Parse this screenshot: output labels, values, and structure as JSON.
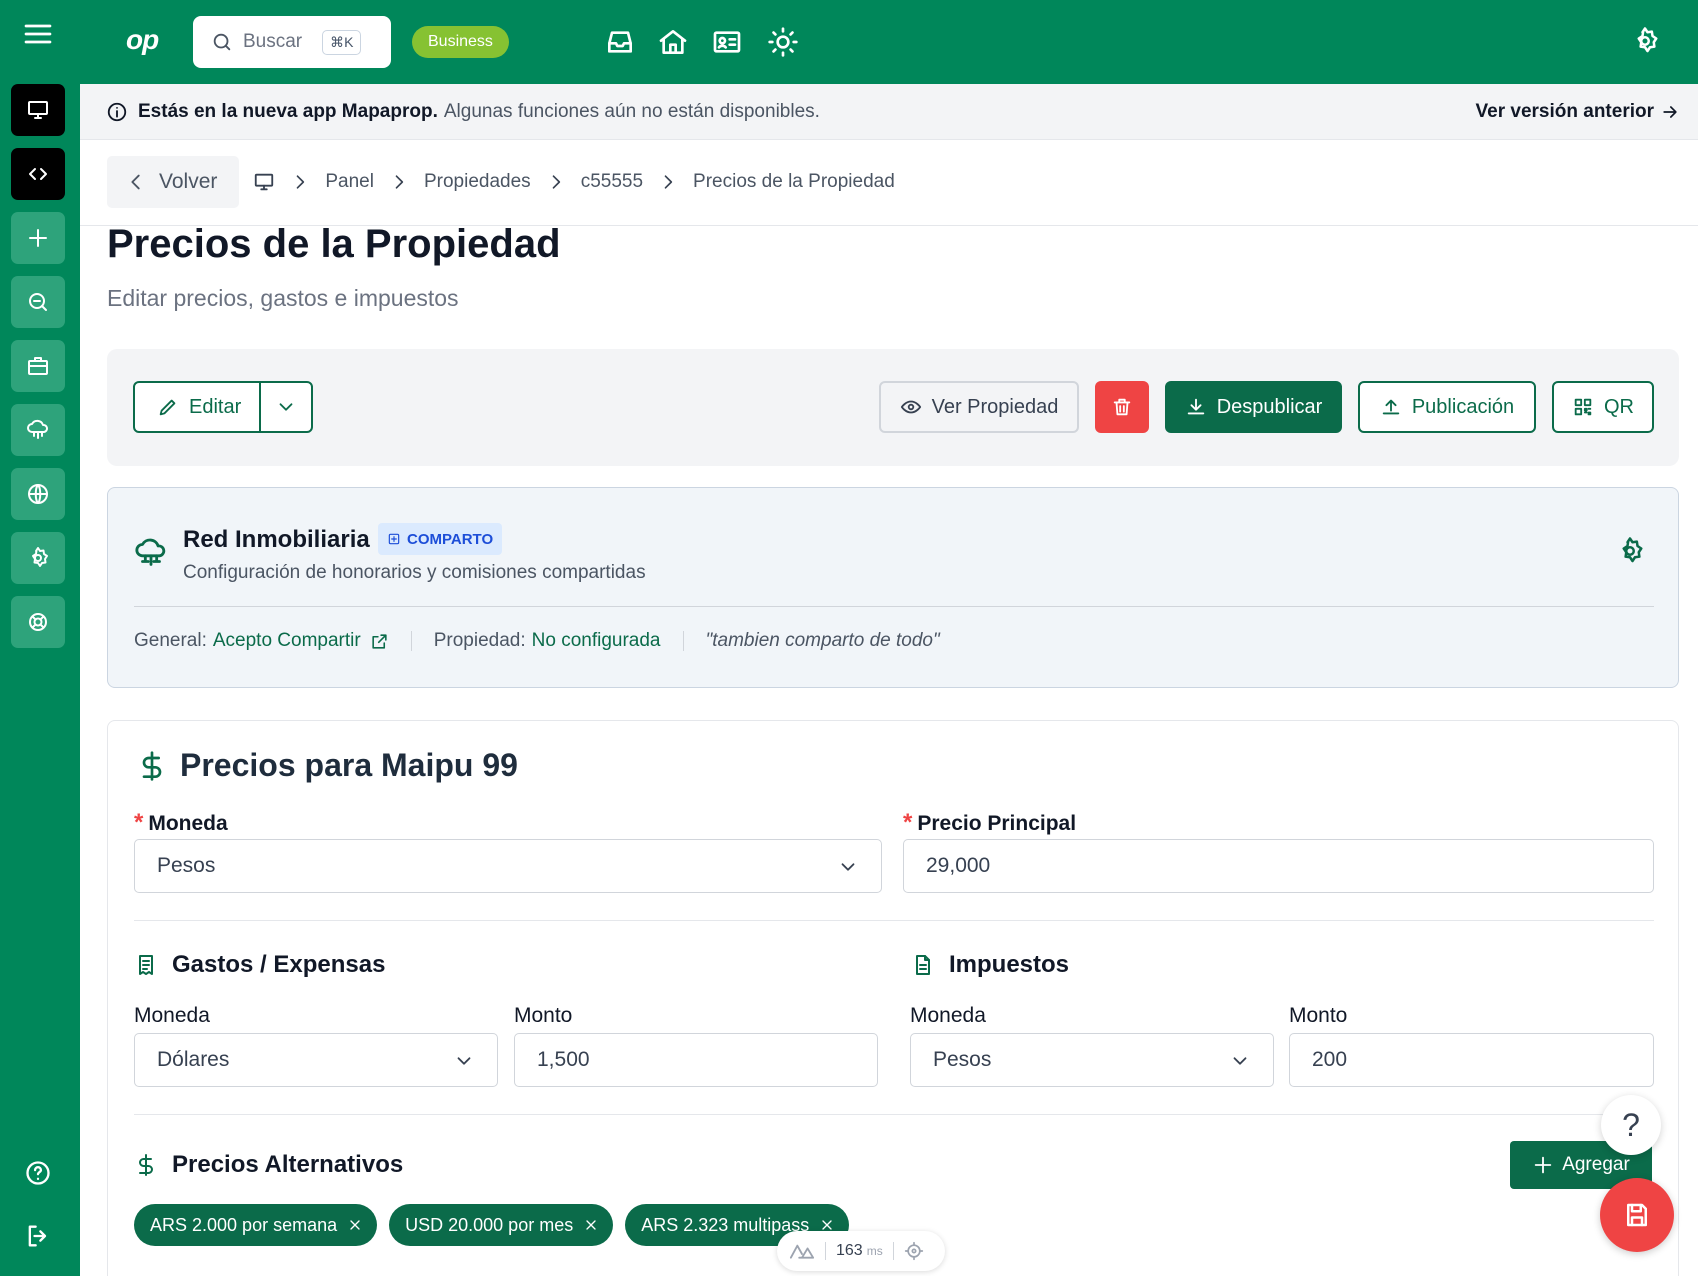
{
  "topbar": {
    "logo": "op",
    "search_label": "Buscar",
    "search_shortcut": "⌘K",
    "plan_badge": "Business",
    "icons": [
      "inbox-icon",
      "home-icon",
      "contact-card-icon",
      "sun-icon"
    ],
    "brand_color": "#00875a"
  },
  "sidebar": {
    "items": [
      "monitor-icon",
      "code-icon",
      "plus-icon",
      "chat-icon",
      "briefcase-icon",
      "cloud-network-icon",
      "globe-icon",
      "gear-icon",
      "lifebuoy-icon"
    ],
    "bottom": [
      "help-icon",
      "logout-icon"
    ]
  },
  "notice": {
    "bold": "Estás en la nueva app Mapaprop.",
    "text": "Algunas funciones aún no están disponibles.",
    "old_version": "Ver versión anterior"
  },
  "breadcrumb": {
    "back": "Volver",
    "items": [
      "Panel",
      "Propiedades",
      "c55555",
      "Precios de la Propiedad"
    ]
  },
  "page": {
    "title": "Precios de la Propiedad",
    "subtitle": "Editar precios, gastos e impuestos"
  },
  "actions": {
    "edit": "Editar",
    "view": "Ver Propiedad",
    "unpublish": "Despublicar",
    "publication": "Publicación",
    "qr": "QR"
  },
  "red": {
    "name": "Red Inmobiliaria",
    "badge": "COMPARTO",
    "description": "Configuración de honorarios y comisiones compartidas",
    "general_label": "General:",
    "general_value": "Acepto Compartir",
    "property_label": "Propiedad:",
    "property_value": "No configurada",
    "note": "\"tambien comparto de todo\""
  },
  "prices": {
    "title": "Precios para Maipu 99",
    "currency_label": "Moneda",
    "currency_value": "Pesos",
    "main_price_label": "Precio Principal",
    "main_price_value": "29,000",
    "expenses": {
      "title": "Gastos / Expensas",
      "currency_label": "Moneda",
      "currency_value": "Dólares",
      "amount_label": "Monto",
      "amount_value": "1,500"
    },
    "taxes": {
      "title": "Impuestos",
      "currency_label": "Moneda",
      "currency_value": "Pesos",
      "amount_label": "Monto",
      "amount_value": "200"
    },
    "alternatives": {
      "title": "Precios Alternativos",
      "add": "Agregar",
      "chips": [
        "ARS 2.000 por semana",
        "USD 20.000 por mes",
        "ARS 2.323 multipass"
      ]
    }
  },
  "fab": {
    "help": "?"
  },
  "devtools": {
    "ms": "163",
    "unit": "ms"
  }
}
